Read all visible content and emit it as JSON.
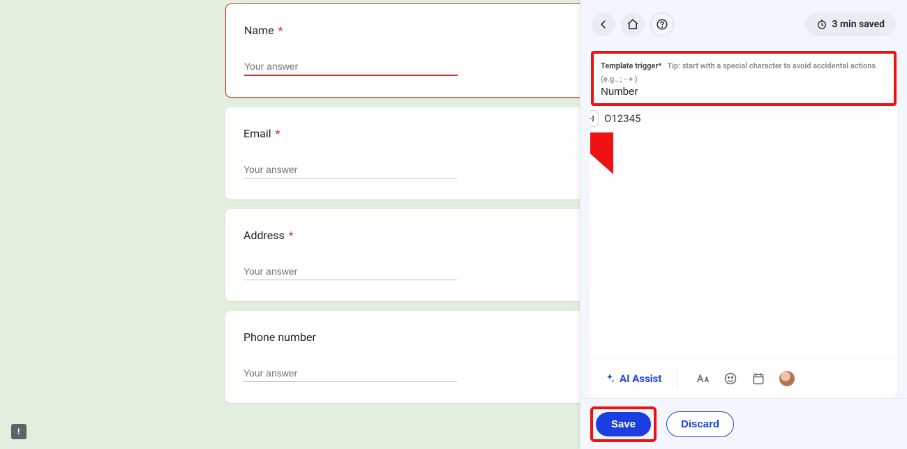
{
  "form": {
    "fields": [
      {
        "label": "Name",
        "required": true,
        "placeholder": "Your answer"
      },
      {
        "label": "Email",
        "required": true,
        "placeholder": "Your answer"
      },
      {
        "label": "Address",
        "required": true,
        "placeholder": "Your answer"
      },
      {
        "label": "Phone number",
        "required": false,
        "placeholder": "Your answer"
      }
    ]
  },
  "panel": {
    "time_saved": "3 min saved",
    "trigger_label": "Template trigger*",
    "trigger_tip": "Tip: start with a special character to avoid accidental actions (e.g., ; - + )",
    "trigger_value": "Number",
    "content_text": "O12345",
    "ai_assist": "AI Assist",
    "save": "Save",
    "discard": "Discard"
  }
}
